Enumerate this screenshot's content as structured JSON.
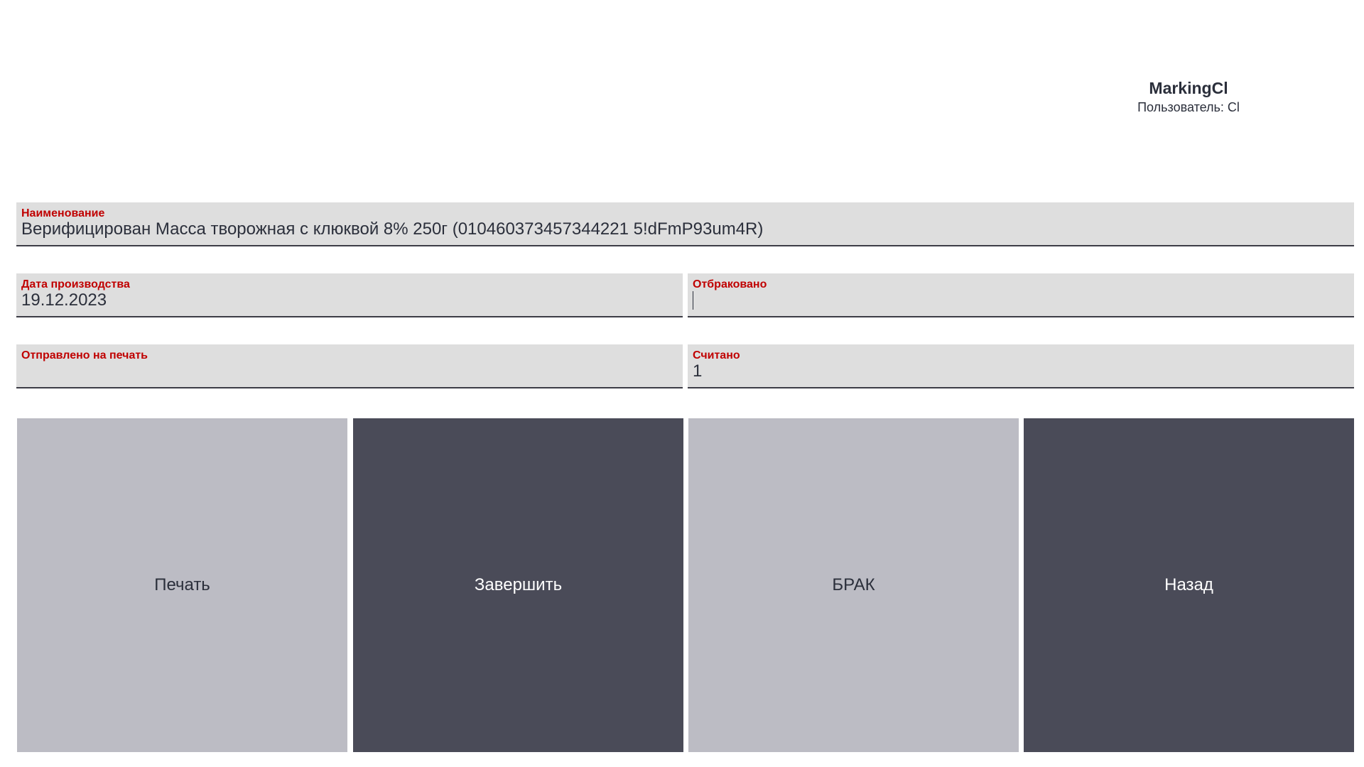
{
  "header": {
    "title": "MarkingCl",
    "user": "Пользователь: Cl"
  },
  "fields": {
    "name": {
      "label": "Наименование",
      "value": "Верифицирован Масса творожная с клюквой 8% 250г (010460373457344221 5!dFmP93um4R)"
    },
    "production_date": {
      "label": "Дата производства",
      "value": "19.12.2023"
    },
    "rejected": {
      "label": "Отбраковано",
      "value": ""
    },
    "sent_to_print": {
      "label": "Отправлено на печать",
      "value": ""
    },
    "scanned": {
      "label": "Считано",
      "value": "1"
    }
  },
  "buttons": {
    "print": "Печать",
    "finish": "Завершить",
    "defect": "БРАК",
    "back": "Назад"
  },
  "colors": {
    "label_red": "#c00000",
    "field_bg": "#dedede",
    "button_light": "#bcbcc4",
    "button_dark": "#4a4b58"
  }
}
